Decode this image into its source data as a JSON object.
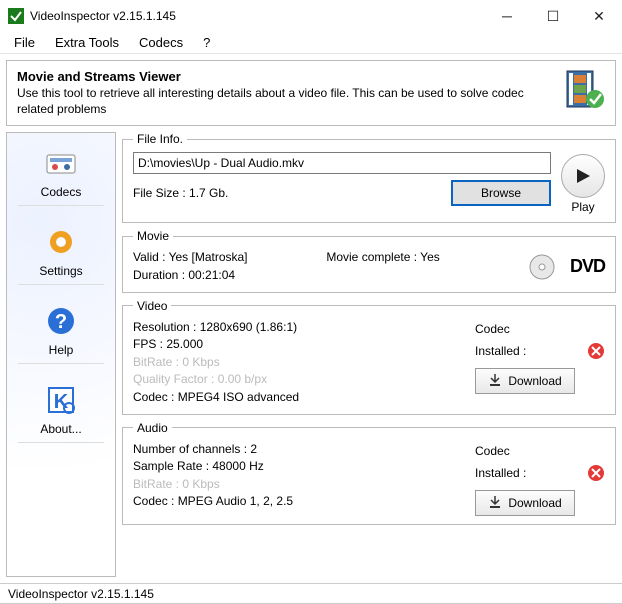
{
  "title": "VideoInspector v2.15.1.145",
  "menu": {
    "file": "File",
    "extra": "Extra Tools",
    "codecs": "Codecs",
    "help": "?"
  },
  "header": {
    "title": "Movie and Streams Viewer",
    "desc": "Use this tool to retrieve all interesting details about a video file. This can be used to solve codec related problems"
  },
  "sidebar": {
    "codecs": "Codecs",
    "settings": "Settings",
    "help": "Help",
    "about": "About..."
  },
  "fileinfo": {
    "legend": "File Info.",
    "path": "D:\\movies\\Up - Dual Audio.mkv",
    "filesize_label": "File Size : 1.7 Gb.",
    "browse": "Browse",
    "play_label": "Play"
  },
  "movie": {
    "legend": "Movie",
    "valid": "Valid : Yes [Matroska]",
    "complete": "Movie complete : Yes",
    "duration": "Duration : 00:21:04",
    "dvd": "DVD"
  },
  "video": {
    "legend": "Video",
    "resolution": "Resolution : 1280x690 (1.86:1)",
    "fps": "FPS : 25.000",
    "bitrate": "BitRate : 0 Kbps",
    "qf": "Quality Factor : 0.00 b/px",
    "codec": "Codec : MPEG4 ISO advanced",
    "codec_label": "Codec",
    "installed_label": "Installed :",
    "download": "Download"
  },
  "audio": {
    "legend": "Audio",
    "channels": "Number of channels : 2",
    "sample": "Sample Rate : 48000 Hz",
    "bitrate": "BitRate : 0 Kbps",
    "codec": "Codec : MPEG Audio 1, 2, 2.5",
    "codec_label": "Codec",
    "installed_label": "Installed :",
    "download": "Download"
  },
  "status": "VideoInspector v2.15.1.145"
}
